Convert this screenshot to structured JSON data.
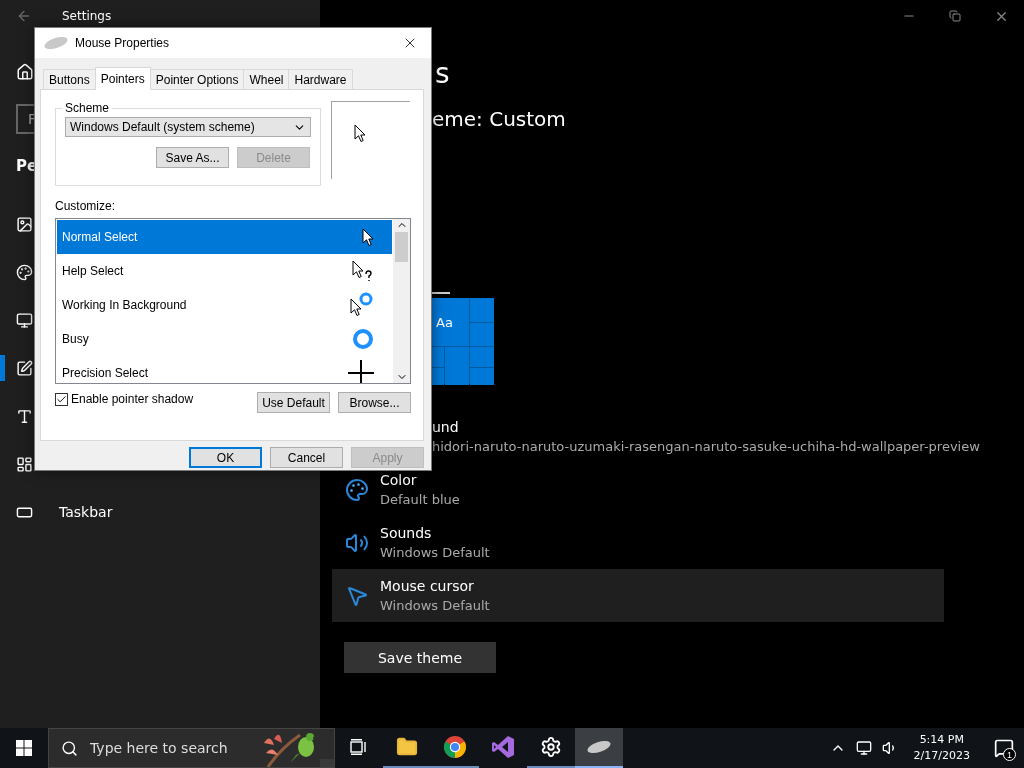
{
  "settings": {
    "title": "Settings",
    "search": {
      "placeholder": "F"
    },
    "section": "Pe",
    "nav": [
      {
        "selected": false
      },
      {
        "selected": false
      },
      {
        "selected": false
      },
      {
        "selected": true
      },
      {
        "selected": false
      },
      {
        "selected": false
      },
      {
        "label": "Taskbar",
        "selected": false
      }
    ],
    "page_title": "s",
    "subtitle": "eme: Custom",
    "preview_label": "Aa",
    "rows": [
      {
        "title": "und",
        "value": "hidori-naruto-naruto-uzumaki-rasengan-naruto-sasuke-uchiha-hd-wallpaper-preview",
        "hovered": false
      },
      {
        "title": "Color",
        "value": "Default blue",
        "hovered": false
      },
      {
        "title": "Sounds",
        "value": "Windows Default",
        "hovered": false
      },
      {
        "title": "Mouse cursor",
        "value": "Windows Default",
        "hovered": true
      }
    ],
    "save_button": "Save theme"
  },
  "dialog": {
    "title": "Mouse Properties",
    "tabs": [
      {
        "label": "Buttons",
        "selected": false
      },
      {
        "label": "Pointers",
        "selected": true
      },
      {
        "label": "Pointer Options",
        "selected": false
      },
      {
        "label": "Wheel",
        "selected": false
      },
      {
        "label": "Hardware",
        "selected": false
      }
    ],
    "scheme": {
      "label": "Scheme",
      "value": "Windows Default (system scheme)",
      "buttons": [
        {
          "label": "Save As...",
          "disabled": false
        },
        {
          "label": "Delete",
          "disabled": true
        }
      ]
    },
    "customize_label": "Customize:",
    "pointers": [
      {
        "name": "Normal Select",
        "selected": true
      },
      {
        "name": "Help Select",
        "selected": false
      },
      {
        "name": "Working In Background",
        "selected": false
      },
      {
        "name": "Busy",
        "selected": false
      },
      {
        "name": "Precision Select",
        "selected": false
      }
    ],
    "pointer_shadow": {
      "label": "Enable pointer shadow",
      "checked": true
    },
    "list_buttons": [
      {
        "label": "Use Default"
      },
      {
        "label": "Browse..."
      }
    ],
    "footer_buttons": [
      {
        "label": "OK",
        "default": true,
        "disabled": false
      },
      {
        "label": "Cancel",
        "default": false,
        "disabled": false
      },
      {
        "label": "Apply",
        "default": false,
        "disabled": true
      }
    ]
  },
  "taskbar": {
    "search": {
      "placeholder": "Type here to search"
    },
    "apps": [
      {
        "running": true,
        "selected": false
      },
      {
        "running": true,
        "selected": false
      },
      {
        "running": false,
        "selected": false
      },
      {
        "running": true,
        "selected": false
      },
      {
        "running": true,
        "selected": true
      }
    ],
    "time": "5:14 PM",
    "date": "2/17/2023",
    "notification_count": "1"
  }
}
